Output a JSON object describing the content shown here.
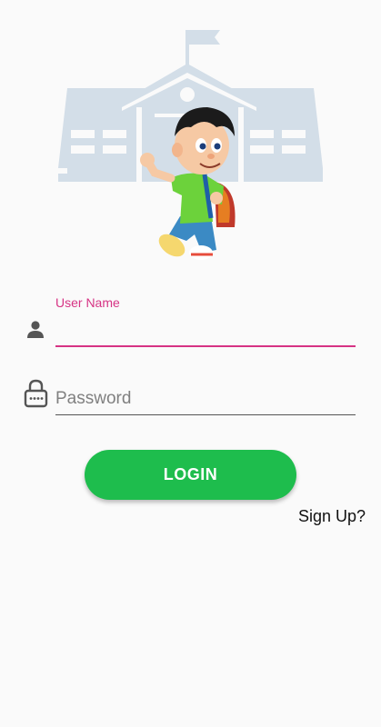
{
  "form": {
    "username_label": "User Name",
    "username_value": "",
    "password_placeholder": "Password",
    "password_value": ""
  },
  "actions": {
    "login_label": "LOGIN",
    "signup_label": "Sign Up?"
  },
  "colors": {
    "accent": "#d63384",
    "login_button": "#1ebd4d",
    "school_silhouette": "#d3dee8"
  },
  "icons": {
    "username": "person-icon",
    "password": "password-lock-icon"
  }
}
